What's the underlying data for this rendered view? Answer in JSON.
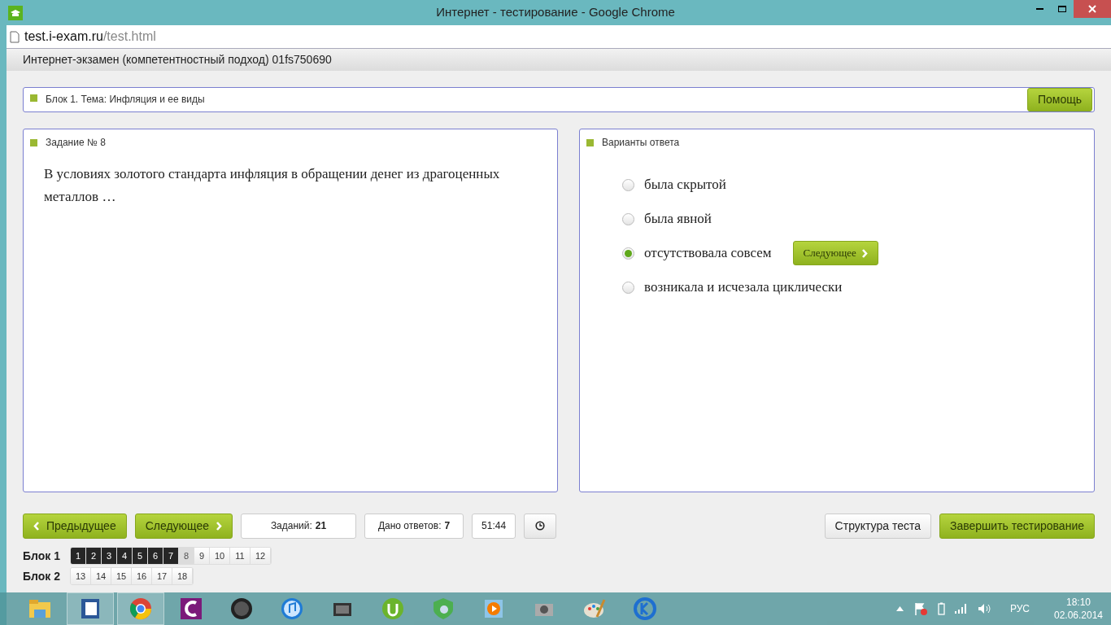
{
  "window": {
    "title": "Интернет - тестирование - Google Chrome"
  },
  "address_bar": {
    "host": "test.i-exam.ru",
    "path": "/test.html"
  },
  "header": {
    "title": "Интернет-экзамен (компетентностный подход) 01fs750690"
  },
  "block_bar": {
    "title": "Блок 1. Тема: Инфляция и ее виды",
    "help_button": "Помощь"
  },
  "task_panel": {
    "title": "Задание № 8",
    "question": "В условиях золотого стандарта инфляция в обращении денег из драгоценных металлов …"
  },
  "answers_panel": {
    "title": "Варианты ответа",
    "next_button": "Следующее",
    "options": [
      {
        "label": "была скрытой",
        "selected": false
      },
      {
        "label": "была явной",
        "selected": false
      },
      {
        "label": "отсутствовала совсем",
        "selected": true
      },
      {
        "label": "возникала и исчезала циклически",
        "selected": false
      }
    ]
  },
  "nav": {
    "prev": "Предыдущее",
    "next": "Следующее",
    "tasks_label": "Заданий:",
    "tasks_count": "21",
    "answered_label": "Дано ответов:",
    "answered_count": "7",
    "timer": "51:44",
    "structure_button": "Структура теста",
    "finish_button": "Завершить тестирование"
  },
  "blocks": [
    {
      "label": "Блок 1",
      "groups": [
        [
          {
            "n": "1",
            "answered": true,
            "current": false
          },
          {
            "n": "2",
            "answered": true,
            "current": false
          },
          {
            "n": "3",
            "answered": true,
            "current": false
          },
          {
            "n": "4",
            "answered": true,
            "current": false
          },
          {
            "n": "5",
            "answered": true,
            "current": false
          },
          {
            "n": "6",
            "answered": true,
            "current": false
          },
          {
            "n": "7",
            "answered": true,
            "current": false
          },
          {
            "n": "8",
            "answered": false,
            "current": true
          },
          {
            "n": "9",
            "answered": false,
            "current": false
          },
          {
            "n": "10",
            "answered": false,
            "current": false
          },
          {
            "n": "11",
            "answered": false,
            "current": false
          },
          {
            "n": "12",
            "answered": false,
            "current": false
          }
        ]
      ]
    },
    {
      "label": "Блок 2",
      "groups": [
        [
          {
            "n": "13",
            "answered": false,
            "current": false
          },
          {
            "n": "14",
            "answered": false,
            "current": false
          },
          {
            "n": "15",
            "answered": false,
            "current": false
          },
          {
            "n": "16",
            "answered": false,
            "current": false
          },
          {
            "n": "17",
            "answered": false,
            "current": false
          },
          {
            "n": "18",
            "answered": false,
            "current": false
          }
        ]
      ]
    }
  ],
  "taskbar": {
    "language": "РУС",
    "time": "18:10",
    "date": "02.06.2014"
  }
}
